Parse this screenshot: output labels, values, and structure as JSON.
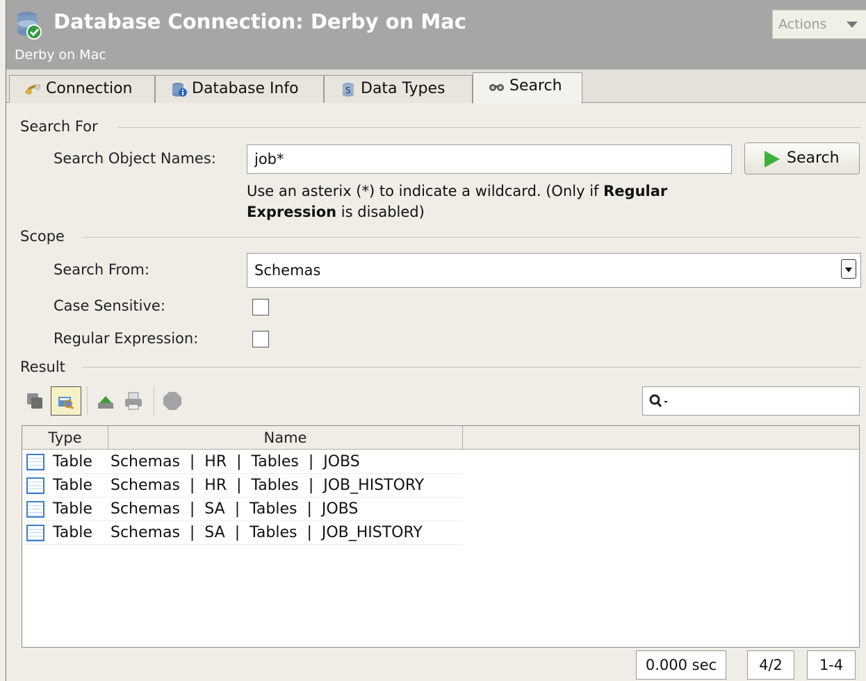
{
  "header": {
    "title": "Database Connection: Derby on Mac",
    "subtitle": "Derby on Mac",
    "actions_label": "Actions"
  },
  "tabs": [
    {
      "label": "Connection",
      "icon": "connection-plug-icon",
      "active": false
    },
    {
      "label": "Database Info",
      "icon": "database-info-icon",
      "active": false
    },
    {
      "label": "Data Types",
      "icon": "data-types-icon",
      "active": false
    },
    {
      "label": "Search",
      "icon": "binoculars-icon",
      "active": true
    }
  ],
  "search_for": {
    "section_label": "Search For",
    "field_label": "Search Object Names:",
    "value": "job*",
    "button_label": "Search",
    "hint_prefix": "Use an asterix (*) to indicate a wildcard. (Only if ",
    "hint_bold1": "Regular",
    "hint_bold2": "Expression",
    "hint_suffix": " is disabled)"
  },
  "scope": {
    "section_label": "Scope",
    "search_from_label": "Search From:",
    "search_from_value": "Schemas",
    "case_sensitive_label": "Case Sensitive:",
    "case_sensitive_checked": false,
    "regex_label": "Regular Expression:",
    "regex_checked": false
  },
  "result": {
    "section_label": "Result",
    "filter_value": "",
    "columns": [
      "Type",
      "Name"
    ],
    "rows": [
      {
        "type": "Table",
        "name": "Schemas  |  HR  |  Tables  |  JOBS"
      },
      {
        "type": "Table",
        "name": "Schemas  |  HR  |  Tables  |  JOB_HISTORY"
      },
      {
        "type": "Table",
        "name": "Schemas  |  SA  |  Tables  |  JOBS"
      },
      {
        "type": "Table",
        "name": "Schemas  |  SA  |  Tables  |  JOB_HISTORY"
      }
    ]
  },
  "status": {
    "time": "0.000 sec",
    "count": "4/2",
    "range": "1-4"
  }
}
